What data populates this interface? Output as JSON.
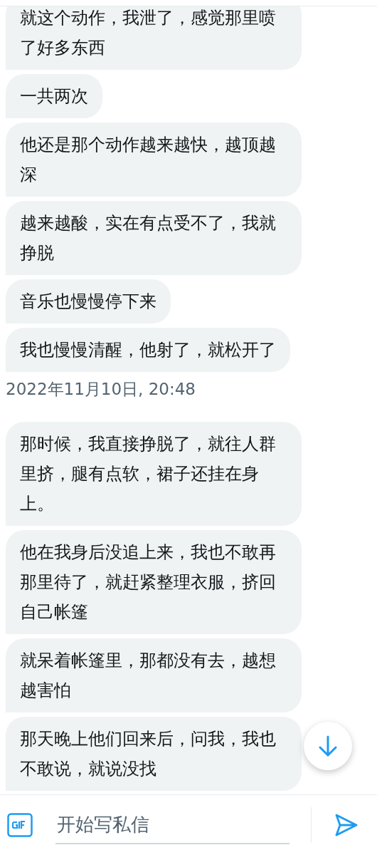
{
  "messages": [
    {
      "kind": "message",
      "text": "就这个动作，我泄了，感觉那里喷了好多东西"
    },
    {
      "kind": "message",
      "text": "一共两次"
    },
    {
      "kind": "message",
      "text": "他还是那个动作越来越快，越顶越深"
    },
    {
      "kind": "message",
      "text": "越来越酸，实在有点受不了，我就挣脱"
    },
    {
      "kind": "message",
      "text": "音乐也慢慢停下来"
    },
    {
      "kind": "message",
      "text": "我也慢慢清醒，他射了，就松开了"
    },
    {
      "kind": "timestamp",
      "text": "2022年11月10日, 20:48"
    },
    {
      "kind": "message",
      "text": "那时候，我直接挣脱了，就往人群里挤，腿有点软，裙子还挂在身上。"
    },
    {
      "kind": "message",
      "text": "他在我身后没追上来，我也不敢再那里待了，就赶紧整理衣服，挤回自己帐篷"
    },
    {
      "kind": "message",
      "text": "就呆着帐篷里，那都没有去，越想越害怕"
    },
    {
      "kind": "message",
      "text": "那天晚上他们回来后，问我，我也不敢说，就说没找"
    }
  ],
  "composer": {
    "placeholder": "开始写私信"
  }
}
